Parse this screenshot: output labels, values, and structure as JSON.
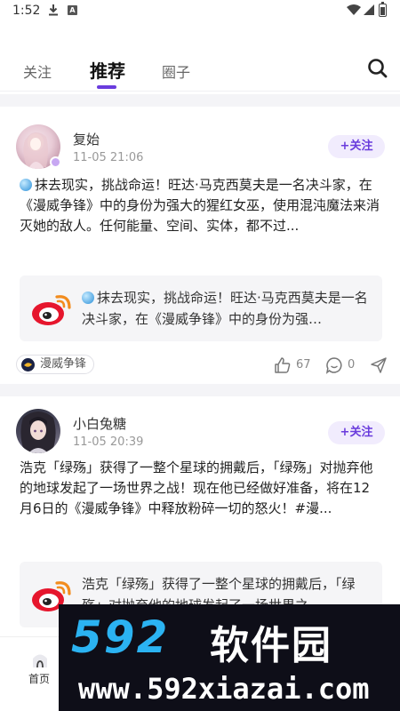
{
  "status_bar": {
    "time": "1:52",
    "a_badge": "A"
  },
  "tabs": [
    {
      "label": "关注",
      "active": false
    },
    {
      "label": "推荐",
      "active": true
    },
    {
      "label": "圈子",
      "active": false
    }
  ],
  "accent_color": "#6a3cdd",
  "posts": [
    {
      "author": "复始",
      "time": "11-05 21:06",
      "follow_label": "+关注",
      "text": "抹去现实，挑战命运！旺达·马克西莫夫是一名决斗家，在《漫威争锋》中的身份为强大的猩红女巫，使用混沌魔法来消灭她的敌人。任何能量、空间、实体，都不过...",
      "quote_text": "抹去现实，挑战命运！旺达·马克西莫夫是一名决斗家，在《漫威争锋》中的身份为强…",
      "topic": "漫威争锋",
      "likes": "67",
      "comments": "0"
    },
    {
      "author": "小白兔糖",
      "time": "11-05 20:39",
      "follow_label": "+关注",
      "text": "浩克「绿殇」获得了一整个星球的拥戴后，「绿殇」对抛弃他的地球发起了一场世界之战！现在他已经做好准备，将在12月6日的《漫威争锋》中释放粉碎一切的怒火！#漫...",
      "quote_text": "浩克「绿殇」获得了一整个星球的拥戴后，「绿殇」对抛弃他的地球发起了一场世界之…"
    }
  ],
  "bottom_nav": {
    "home_label": "首页"
  },
  "watermark": {
    "logo_num": "592",
    "logo_cn": "软件园",
    "url": "www.592xiazai.com"
  }
}
